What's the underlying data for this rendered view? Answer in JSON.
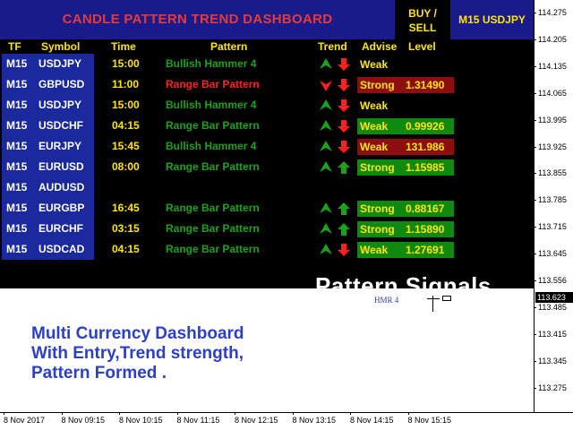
{
  "dashboard": {
    "title": "CANDLE PATTERN TREND DASHBOARD",
    "buy_sell_line1": "BUY /",
    "buy_sell_line2": "SELL",
    "symbol_timeframe": "M15  USDJPY",
    "headers": {
      "tf": "TF",
      "symbol": "Symbol",
      "time": "Time",
      "pattern": "Pattern",
      "trend": "Trend",
      "advise": "Advise",
      "level": "Level"
    },
    "rows": [
      {
        "tf": "M15",
        "symbol": "USDJPY",
        "time": "15:00",
        "pattern": "Bullish Hammer 4",
        "pattern_color": "green",
        "trend1": "up",
        "trend1_color": "green",
        "trend2": "down",
        "trend2_color": "red",
        "advise": "Weak",
        "advise_bg": "none",
        "level": ""
      },
      {
        "tf": "M15",
        "symbol": "GBPUSD",
        "time": "11:00",
        "pattern": "Range Bar Pattern",
        "pattern_color": "red",
        "trend1": "down",
        "trend1_color": "red",
        "trend2": "down",
        "trend2_color": "red",
        "advise": "Strong",
        "advise_bg": "red",
        "level": "1.31490"
      },
      {
        "tf": "M15",
        "symbol": "USDJPY",
        "time": "15:00",
        "pattern": "Bullish Hammer 4",
        "pattern_color": "green",
        "trend1": "up",
        "trend1_color": "green",
        "trend2": "down",
        "trend2_color": "red",
        "advise": "Weak",
        "advise_bg": "none",
        "level": ""
      },
      {
        "tf": "M15",
        "symbol": "USDCHF",
        "time": "04:15",
        "pattern": "Range Bar Pattern",
        "pattern_color": "green",
        "trend1": "up",
        "trend1_color": "green",
        "trend2": "down",
        "trend2_color": "red",
        "advise": "Weak",
        "advise_bg": "green",
        "level": "0.99926"
      },
      {
        "tf": "M15",
        "symbol": "EURJPY",
        "time": "15:45",
        "pattern": "Bullish Hammer 4",
        "pattern_color": "green",
        "trend1": "up",
        "trend1_color": "green",
        "trend2": "down",
        "trend2_color": "red",
        "advise": "Weak",
        "advise_bg": "red",
        "level": "131.986"
      },
      {
        "tf": "M15",
        "symbol": "EURUSD",
        "time": "08:00",
        "pattern": "Range Bar Pattern",
        "pattern_color": "green",
        "trend1": "up",
        "trend1_color": "green",
        "trend2": "up",
        "trend2_color": "green",
        "advise": "Strong",
        "advise_bg": "green",
        "level": "1.15985"
      },
      {
        "tf": "M15",
        "symbol": "AUDUSD",
        "time": "",
        "pattern": "",
        "pattern_color": "green",
        "trend1": "",
        "trend1_color": "",
        "trend2": "",
        "trend2_color": "",
        "advise": "",
        "advise_bg": "none",
        "level": ""
      },
      {
        "tf": "M15",
        "symbol": "EURGBP",
        "time": "16:45",
        "pattern": "Range Bar Pattern",
        "pattern_color": "green",
        "trend1": "up",
        "trend1_color": "green",
        "trend2": "up",
        "trend2_color": "green",
        "advise": "Strong",
        "advise_bg": "green",
        "level": "0.88167"
      },
      {
        "tf": "M15",
        "symbol": "EURCHF",
        "time": "03:15",
        "pattern": "Range Bar Pattern",
        "pattern_color": "green",
        "trend1": "up",
        "trend1_color": "green",
        "trend2": "up",
        "trend2_color": "green",
        "advise": "Strong",
        "advise_bg": "green",
        "level": "1.15890"
      },
      {
        "tf": "M15",
        "symbol": "USDCAD",
        "time": "04:15",
        "pattern": "Range Bar Pattern",
        "pattern_color": "green",
        "trend1": "up",
        "trend1_color": "green",
        "trend2": "down",
        "trend2_color": "red",
        "advise": "Weak",
        "advise_bg": "green",
        "level": "1.27691"
      }
    ],
    "overlay_text": "Pattern Signals",
    "marker_label": "HMR 4"
  },
  "promo": {
    "line1": "Multi Currency Dashboard",
    "line2": "With Entry,Trend strength,",
    "line3": "Pattern Formed ."
  },
  "axis": {
    "y_ticks": [
      "114.275",
      "114.205",
      "114.135",
      "114.065",
      "113.995",
      "113.925",
      "113.855",
      "113.785",
      "113.715",
      "113.645",
      "113.556",
      "113.485",
      "113.415",
      "113.345",
      "113.275"
    ],
    "current_price": "113.623",
    "x_ticks": [
      "8 Nov 2017",
      "8 Nov 09:15",
      "8 Nov 10:15",
      "8 Nov 11:15",
      "8 Nov 12:15",
      "8 Nov 13:15",
      "8 Nov 14:15",
      "8 Nov 15:15"
    ]
  },
  "colors": {
    "panel_bg": "#000000",
    "title_bg": "#1a1a8c",
    "title_text": "#e53a3a",
    "header_text": "#ffe600",
    "symbol_col_bg": "#1a2a9c",
    "pattern_green": "#1ba11b",
    "pattern_red": "#ff2020",
    "advise_green_bg": "#0f8a0f",
    "advise_red_bg": "#8c0e0e",
    "promo_text": "#2b3fc9"
  }
}
